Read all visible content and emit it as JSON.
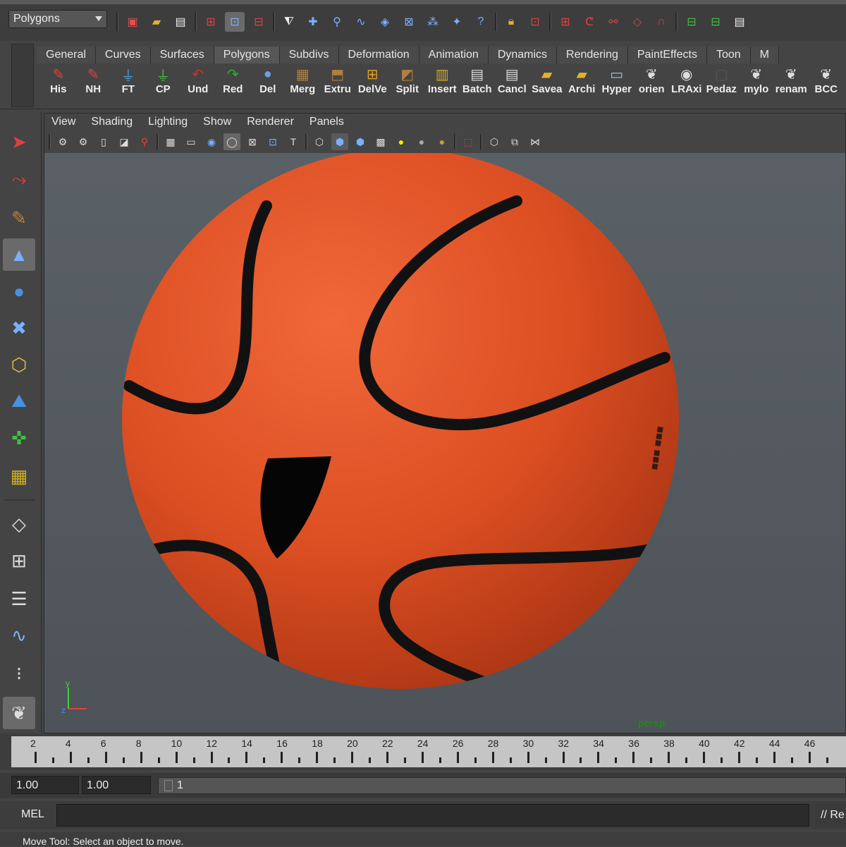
{
  "status_line": {
    "mode_menu": "Polygons",
    "icons": [
      "new-scene-icon",
      "open-scene-icon",
      "save-scene-icon",
      "select-hierarchy-icon",
      "select-object-icon",
      "select-component-icon",
      "snap-grid-icon",
      "snap-curve-icon",
      "snap-point-icon",
      "snap-surface-icon",
      "history-icon",
      "render-icon",
      "ipr-icon",
      "lock-icon",
      "input-ops-icon",
      "construction-history-icon",
      "magnet-icon",
      "hypershade-icon",
      "render-view-icon",
      "layers-icon"
    ]
  },
  "shelf": {
    "tabs": [
      "General",
      "Curves",
      "Surfaces",
      "Polygons",
      "Subdivs",
      "Deformation",
      "Animation",
      "Dynamics",
      "Rendering",
      "PaintEffects",
      "Toon",
      "M"
    ],
    "active_tab": "Polygons",
    "buttons": [
      {
        "label": "His",
        "icon": "pencil-icon",
        "color": "#e04040"
      },
      {
        "label": "NH",
        "icon": "pencil-icon",
        "color": "#e04040"
      },
      {
        "label": "FT",
        "icon": "axis-icon",
        "color": "#40a0e0"
      },
      {
        "label": "CP",
        "icon": "axis-icon",
        "color": "#40c040"
      },
      {
        "label": "Und",
        "icon": "undo-arrow-icon",
        "color": "#d03030"
      },
      {
        "label": "Red",
        "icon": "redo-arrow-icon",
        "color": "#30b030"
      },
      {
        "label": "Del",
        "icon": "sphere-icon",
        "color": "#6aa0e0"
      },
      {
        "label": "Merg",
        "icon": "merge-icon",
        "color": "#b08040"
      },
      {
        "label": "Extru",
        "icon": "extrude-icon",
        "color": "#b08040"
      },
      {
        "label": "DelVe",
        "icon": "vertex-grid-icon",
        "color": "#e0a020"
      },
      {
        "label": "Split",
        "icon": "split-icon",
        "color": "#b08040"
      },
      {
        "label": "Insert",
        "icon": "insert-edge-icon",
        "color": "#d0b020"
      },
      {
        "label": "Batch",
        "icon": "clapper-icon",
        "color": "#dddddd"
      },
      {
        "label": "Cancl",
        "icon": "clapper-icon",
        "color": "#dddddd"
      },
      {
        "label": "Savea",
        "icon": "folder-icon",
        "color": "#e0b030"
      },
      {
        "label": "Archi",
        "icon": "folder-icon",
        "color": "#e0b030"
      },
      {
        "label": "Hyper",
        "icon": "window-icon",
        "color": "#a0c0e0"
      },
      {
        "label": "orien",
        "icon": "maya-logo-icon",
        "color": "#dddddd"
      },
      {
        "label": "LRAxi",
        "icon": "eye-icon",
        "color": "#dddddd"
      },
      {
        "label": "Pedaz",
        "icon": "blank-icon",
        "color": "#555555"
      },
      {
        "label": "mylo",
        "icon": "maya-logo-icon",
        "color": "#dddddd"
      },
      {
        "label": "renam",
        "icon": "maya-logo-icon",
        "color": "#dddddd"
      },
      {
        "label": "BCC",
        "icon": "maya-logo-icon",
        "color": "#dddddd"
      }
    ]
  },
  "panel": {
    "menus": [
      "View",
      "Shading",
      "Lighting",
      "Show",
      "Renderer",
      "Panels"
    ],
    "camera": "persp"
  },
  "time_slider": {
    "ticks": [
      "2",
      "4",
      "6",
      "8",
      "10",
      "12",
      "14",
      "16",
      "18",
      "20",
      "22",
      "24",
      "26",
      "28",
      "30",
      "32",
      "34",
      "36",
      "38",
      "40",
      "42",
      "44",
      "46"
    ]
  },
  "range": {
    "start": "1.00",
    "playback_start": "1.00",
    "current": "1"
  },
  "command_line": {
    "label": "MEL",
    "result": "// Re"
  },
  "help_line": "Move Tool: Select an object to move."
}
